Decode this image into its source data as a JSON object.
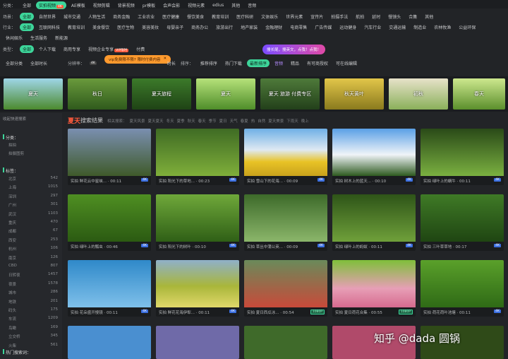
{
  "top": {
    "cat_label": "分类：",
    "cats": [
      "全部",
      "实拍视频",
      "AE模板",
      "视频剪辑",
      "背景视频",
      "pr模板",
      "会声会影",
      "视频元素",
      "edius",
      "其他",
      "音频"
    ],
    "cats_active": 1,
    "cats_badge": "4K"
  },
  "scene": {
    "label": "场景：",
    "items": [
      "全部",
      "自然世界",
      "城市交通",
      "人物生活",
      "商务金融",
      "工业农业",
      "医疗健康",
      "餐饮美食",
      "教育培训",
      "医疗科研",
      "文体娱乐",
      "世界元素",
      "宣传片",
      "拍摄手法",
      "航拍",
      "延时",
      "慢镜头",
      "合集",
      "其他"
    ]
  },
  "industry": {
    "label": "行业：",
    "items": [
      "全部",
      "互联网科技",
      "教育培训",
      "美食餐饮",
      "医疗生物",
      "美容美妆",
      "母婴亲子",
      "商务办公",
      "旅游出行",
      "地产家装",
      "金融理财",
      "电商零售",
      "广告传媒",
      "运动健身",
      "汽车行业",
      "交通运输",
      "制造业",
      "农林牧渔",
      "公益环保",
      "休闲娱乐",
      "生活服务",
      "新能源"
    ]
  },
  "type": {
    "label": "类型：",
    "items": [
      "全部",
      "个人下载",
      "商用专享",
      "视频企业专享",
      "付费"
    ],
    "vip_badge": "VIP限时",
    "tip": "vip免费限不限? 限时付费内容",
    "tip_close": "✕",
    "hint": "搜长尾，搜英文，点我！点我！"
  },
  "sort": {
    "all_cat": "全部分类",
    "all_dur": "全部时长",
    "res_label": "分辨率：",
    "res_4k": "4K",
    "time": "时长",
    "order_label": "排序：",
    "order_items": [
      "推荐排序",
      "热门下载"
    ],
    "new": "最新排序",
    "opt1": "音频",
    "opt2": "精品",
    "opt3": "有可商授权",
    "opt4": "可在线编辑"
  },
  "banner": {
    "scenes": [
      "夏天",
      "秋日",
      "夏天旅程",
      "夏天",
      "夏天 旅游 付费专区",
      "秋天黄叶",
      "初秋",
      "春天"
    ]
  },
  "sidebar": {
    "collect": "收起快速搜索",
    "cat_title": "分类：",
    "cat_items": [
      "拍拍",
      "拍摄图剪"
    ],
    "tag_title": "标签：",
    "tags": [
      {
        "name": "北京",
        "count": "542"
      },
      {
        "name": "上海",
        "count": "1015"
      },
      {
        "name": "深圳",
        "count": "297"
      },
      {
        "name": "广州",
        "count": "301"
      },
      {
        "name": "武汉",
        "count": "1103"
      },
      {
        "name": "重庆",
        "count": "470"
      },
      {
        "name": "成都",
        "count": "67"
      },
      {
        "name": "西安",
        "count": "253"
      },
      {
        "name": "杭州",
        "count": "106"
      },
      {
        "name": "南京",
        "count": "126"
      },
      {
        "name": "CBD",
        "count": "807"
      },
      {
        "name": "日转夜",
        "count": "1457"
      },
      {
        "name": "夜景",
        "count": "1578"
      },
      {
        "name": "城市",
        "count": "286"
      },
      {
        "name": "地铁",
        "count": "201"
      },
      {
        "name": "码头",
        "count": "175"
      },
      {
        "name": "车流",
        "count": "1209"
      },
      {
        "name": "鸟瞰",
        "count": "169"
      },
      {
        "name": "立交桥",
        "count": "345"
      },
      {
        "name": "火柴",
        "count": "561"
      }
    ],
    "hot": "热门搜索词："
  },
  "results": {
    "keyword": "夏天",
    "suffix": "搜索结果",
    "related": [
      "相关搜索：",
      "夏天风景",
      "夏天夏天",
      "冬天",
      "夏季",
      "秋天",
      "春天",
      "季节",
      "夏日",
      "天气",
      "春夏",
      "热",
      "自然",
      "夏天美景",
      "下雨天",
      "晚上"
    ]
  },
  "grid": [
    {
      "cap": "实拍 鲜花云中星峡... · 00:11",
      "res": "4K"
    },
    {
      "cap": "实拍 阳光下的草地... · 00:23",
      "res": "4K"
    },
    {
      "cap": "实拍 雪山下的花海... · 00:09",
      "res": "4K"
    },
    {
      "cap": "实拍 树木上的蓝天... · 00:10",
      "res": "4K"
    },
    {
      "cap": "实拍 绿叶上的蜗牛 · 00:11",
      "res": "4K"
    },
    {
      "cap": "实拍 绿叶上的瓢虫 · 00:46",
      "res": "4K"
    },
    {
      "cap": "实拍 阳光下的树叶 · 00:10",
      "res": "4K"
    },
    {
      "cap": "实拍 草丛中蒲公英... · 00:09",
      "res": "4K"
    },
    {
      "cap": "实拍 绿叶上的蚂蚁 · 00:11",
      "res": "4K"
    },
    {
      "cap": "实拍 三叶草草地 · 00:17",
      "res": "4K"
    },
    {
      "cap": "实拍 花朵盛开慢镜 · 00:11",
      "res": "4K"
    },
    {
      "cap": "实拍 鲜花花海伊犁... · 00:11",
      "res": "4K"
    },
    {
      "cap": "实拍 夏日西瓜冰... · 00:54",
      "res": "1080P"
    },
    {
      "cap": "实拍 夏日荷花合集 · 00:55",
      "res": "1080P"
    },
    {
      "cap": "实拍 荷花荷叶池塘 · 00:11",
      "res": "4K"
    }
  ],
  "watermark": "知乎 @dada 圆锅",
  "colors": {
    "accent": "#3dd59a",
    "hot": "#ff5a3c",
    "bg": "#222427"
  }
}
